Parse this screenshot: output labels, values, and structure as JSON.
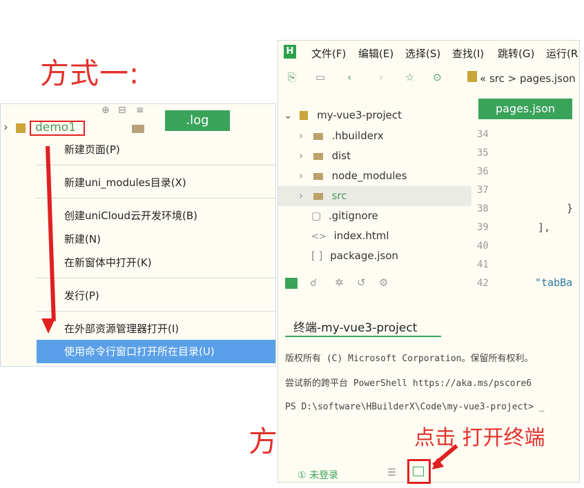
{
  "headings": {
    "method1": "方式一:",
    "method2": "方式二:"
  },
  "left_panel": {
    "log_tab": ".log",
    "demo_label": "demo1",
    "context_menu": [
      "新建页面(P)",
      "新建uni_modules目录(X)",
      "创建uniCloud云开发环境(B)",
      "新建(N)",
      "在新窗体中打开(K)",
      "发行(P)",
      "在外部资源管理器打开(I)",
      "使用命令行窗口打开所在目录(U)"
    ]
  },
  "menubar": [
    "文件(F)",
    "编辑(E)",
    "选择(S)",
    "查找(I)",
    "跳转(G)",
    "运行(R"
  ],
  "breadcrumb": "« src > pages.json",
  "tree": {
    "root": "my-vue3-project",
    "items": [
      ".hbuilderx",
      "dist",
      "node_modules",
      "src",
      ".gitignore",
      "index.html",
      "package.json"
    ]
  },
  "editor": {
    "tab": "pages.json",
    "line_numbers": [
      "34",
      "35",
      "36",
      "37",
      "38",
      "39",
      "40",
      "41",
      "42"
    ],
    "code": [
      "}",
      "],",
      "\"tabBa"
    ]
  },
  "terminal": {
    "title": "终端-my-vue3-project",
    "lines": [
      "版权所有 (C) Microsoft Corporation。保留所有权利。",
      "尝试新的跨平台 PowerShell https://aka.ms/pscore6",
      "PS D:\\software\\HBuilderX\\Code\\my-vue3-project> _"
    ]
  },
  "status": {
    "login": "未登录"
  },
  "annotation": "点击 打开终端",
  "colors": {
    "accent_green": "#3aa35a",
    "highlight_red": "#e02020",
    "menu_selected": "#5aa0e8"
  }
}
